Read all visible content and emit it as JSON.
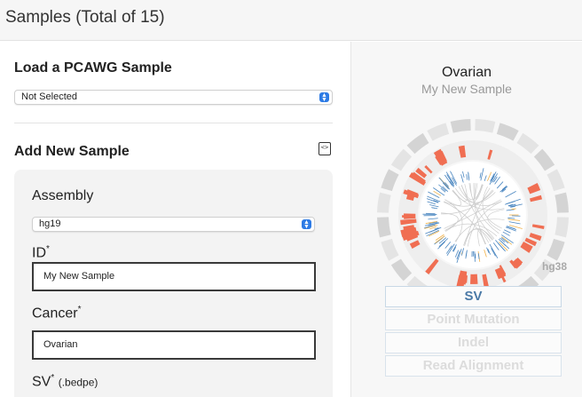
{
  "header": {
    "title": "Samples (Total of 15)"
  },
  "load_section": {
    "title": "Load a PCAWG Sample",
    "select_value": "Not Selected"
  },
  "add_section": {
    "title": "Add New Sample",
    "assembly_label": "Assembly",
    "assembly_value": "hg19",
    "id_label": "ID",
    "id_value": "My New Sample",
    "cancer_label": "Cancer",
    "cancer_value": "Ovarian",
    "sv_label": "SV",
    "sv_ext": "(.bedpe)",
    "required_mark": "*"
  },
  "preview": {
    "title": "Ovarian",
    "subtitle": "My New Sample",
    "assembly_badge": "hg38",
    "tabs": [
      {
        "label": "SV",
        "active": true
      },
      {
        "label": "Point Mutation",
        "active": false
      },
      {
        "label": "Indel",
        "active": false
      },
      {
        "label": "Read Alignment",
        "active": false
      }
    ]
  },
  "colors": {
    "accent": "#4a79a6",
    "select_arrow": "#2d7be5",
    "cnv_bar": "#f06e52",
    "sv_line": "#4a86c0"
  }
}
